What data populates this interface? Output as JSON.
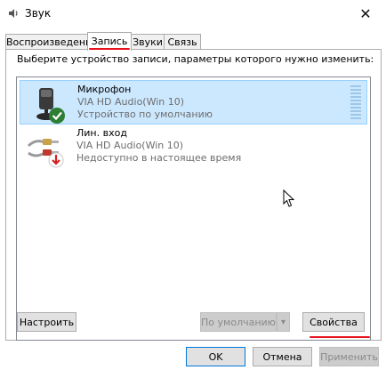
{
  "window": {
    "title": "Звук",
    "icon": "speaker-icon",
    "close_glyph": "✕"
  },
  "tabs": [
    {
      "label": "Воспроизведение",
      "active": false
    },
    {
      "label": "Запись",
      "active": true
    },
    {
      "label": "Звуки",
      "active": false
    },
    {
      "label": "Связь",
      "active": false
    }
  ],
  "panel": {
    "instruction": "Выберите устройство записи, параметры которого нужно изменить:"
  },
  "devices": [
    {
      "name": "Микрофон",
      "driver": "VIA HD Audio(Win 10)",
      "status": "Устройство по умолчанию",
      "selected": true,
      "icon": "microphone-icon",
      "badge": "default-check-icon"
    },
    {
      "name": "Лин. вход",
      "driver": "VIA HD Audio(Win 10)",
      "status": "Недоступно в настоящее время",
      "selected": false,
      "icon": "line-in-icon",
      "badge": "unavailable-arrow-icon"
    }
  ],
  "panel_buttons": {
    "configure": "Настроить",
    "default": "По умолчанию",
    "default_arrow": "▾",
    "properties": "Свойства"
  },
  "dialog_buttons": {
    "ok": "OK",
    "cancel": "Отмена",
    "apply": "Применить"
  },
  "colors": {
    "selection": "#cce8ff",
    "accent": "#0078d7",
    "annotation": "#e8121d",
    "check": "#2d7d32"
  }
}
